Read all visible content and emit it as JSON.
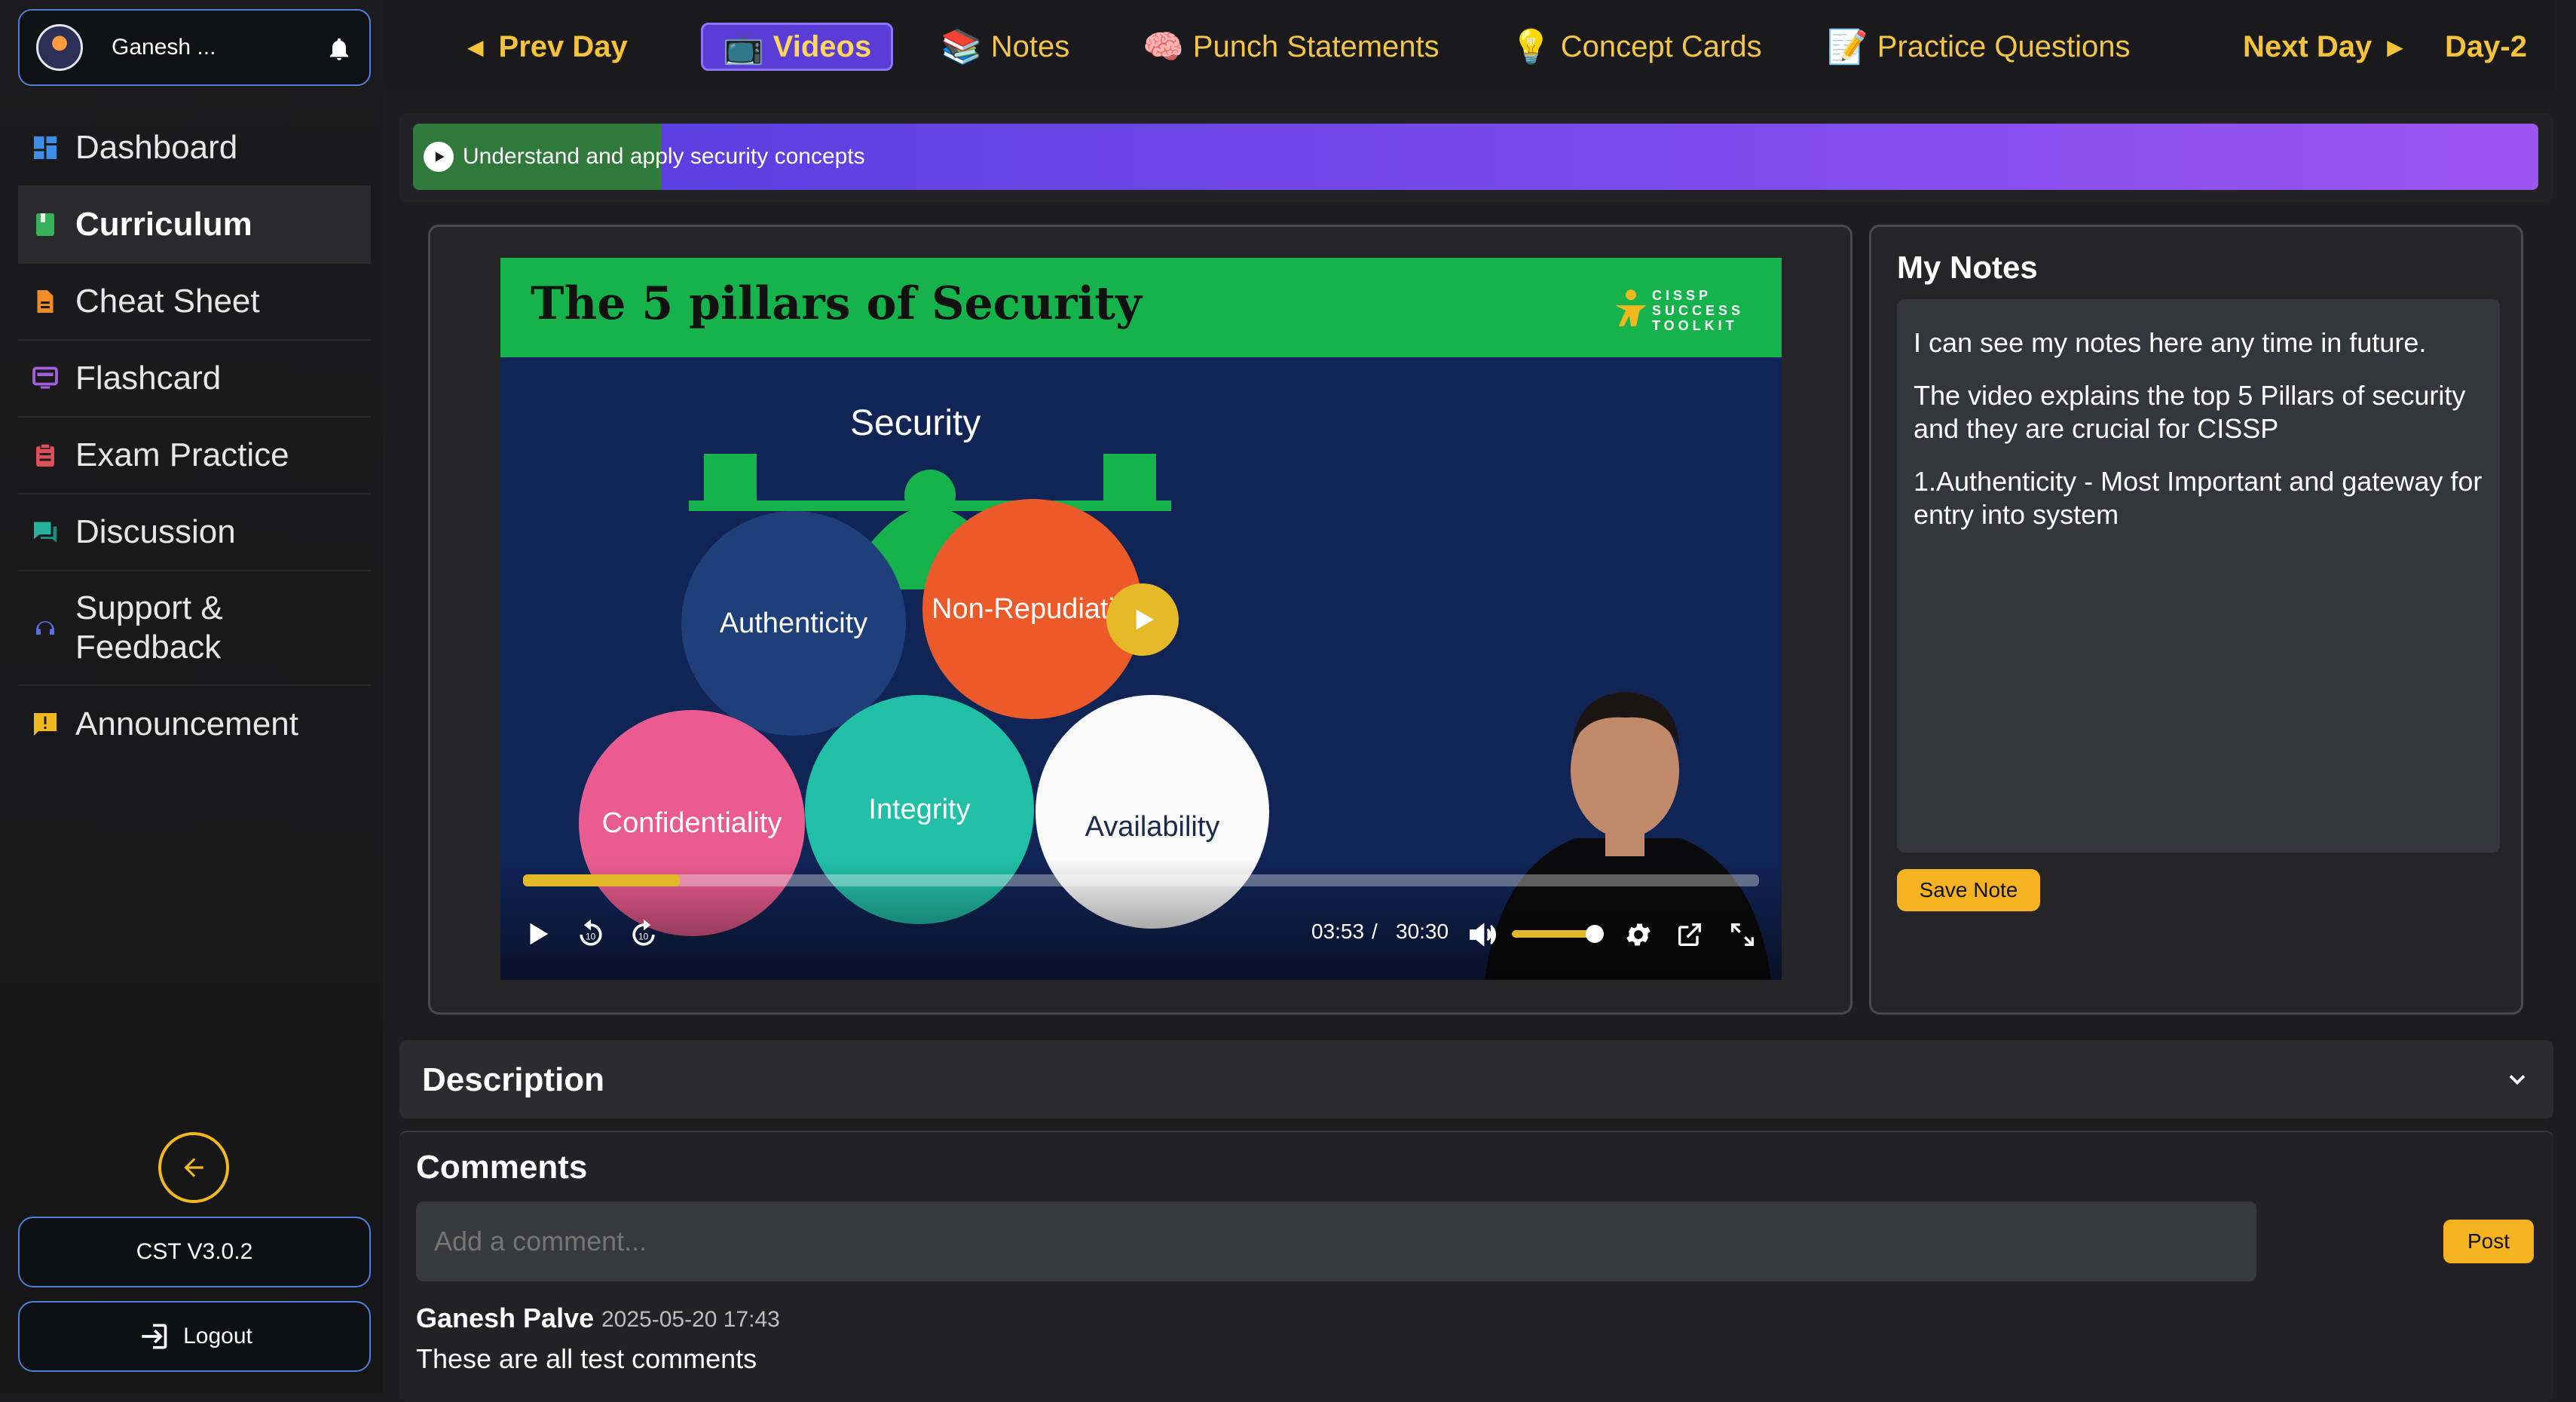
{
  "user": {
    "name": "Ganesh ..."
  },
  "sidebar": {
    "items": [
      {
        "label": "Dashboard",
        "icon": "dashboard-icon",
        "color": "#3e8ee8"
      },
      {
        "label": "Curriculum",
        "icon": "book-icon",
        "color": "#38b259"
      },
      {
        "label": "Cheat Sheet",
        "icon": "document-icon",
        "color": "#f28c28"
      },
      {
        "label": "Flashcard",
        "icon": "card-icon",
        "color": "#a45fe0"
      },
      {
        "label": "Exam Practice",
        "icon": "clipboard-icon",
        "color": "#e0505a"
      },
      {
        "label": "Discussion",
        "icon": "chat-icon",
        "color": "#27b2a0"
      },
      {
        "label": "Support & Feedback",
        "icon": "support-icon",
        "color": "#5b6ee8"
      },
      {
        "label": "Announcement",
        "icon": "announcement-icon",
        "color": "#f2b81f"
      }
    ],
    "version": "CST V3.0.2",
    "logout": "Logout"
  },
  "topnav": {
    "prev": "Prev Day",
    "tabs": [
      {
        "label": "Videos",
        "emoji": "📺"
      },
      {
        "label": "Notes",
        "emoji": "📚"
      },
      {
        "label": "Punch Statements",
        "emoji": "🧠"
      },
      {
        "label": "Concept Cards",
        "emoji": "💡"
      },
      {
        "label": "Practice Questions",
        "emoji": "📝"
      }
    ],
    "next": "Next Day",
    "day": "Day-2"
  },
  "banner": {
    "text": "Understand and apply security concepts",
    "progress": 0.12
  },
  "video": {
    "title": "The 5 pillars of Security",
    "logo_lines": [
      "CISSP",
      "SUCCESS",
      "TOOLKIT"
    ],
    "scale_label": "Security",
    "pillars": [
      "Authenticity",
      "Non-Repudiation",
      "Confidentiality",
      "Integrity",
      "Availability"
    ],
    "current_time": "03:53",
    "separator": "/",
    "duration": "30:30",
    "progress": 0.127
  },
  "notes": {
    "title": "My Notes",
    "paragraphs": [
      "I can see my notes here any time in future.",
      "The video explains the top 5 Pillars of security and they are crucial for CISSP",
      "1.Authenticity - Most Important and gateway for entry into system"
    ],
    "save_label": "Save Note"
  },
  "description": {
    "title": "Description"
  },
  "comments": {
    "title": "Comments",
    "placeholder": "Add a comment...",
    "post_label": "Post",
    "items": [
      {
        "author": "Ganesh Palve",
        "date": "2025-05-20 17:43",
        "text": "These are all test comments"
      }
    ]
  }
}
